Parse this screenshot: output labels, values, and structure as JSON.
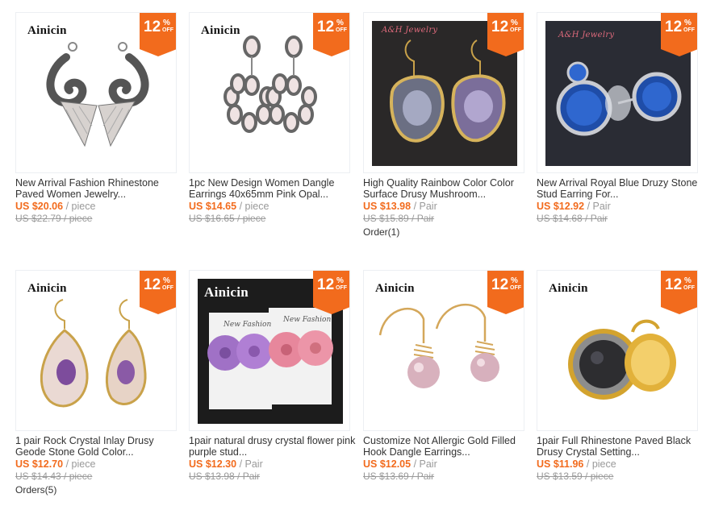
{
  "products": [
    {
      "brand": "Ainicin",
      "discount": "12",
      "pct": "%",
      "off": "OFF",
      "title": "New Arrival Fashion Rhinestone Paved Women Jewelry...",
      "price": "US $20.06",
      "unit": "/ piece",
      "orig": "US $22.79 / piece",
      "orders": ""
    },
    {
      "brand": "Ainicin",
      "discount": "12",
      "pct": "%",
      "off": "OFF",
      "title": "1pc New Design Women Dangle Earrings 40x65mm Pink Opal...",
      "price": "US $14.65",
      "unit": "/ piece",
      "orig": "US $16.65 / piece",
      "orders": ""
    },
    {
      "brand": "A&H Jewelry",
      "discount": "12",
      "pct": "%",
      "off": "OFF",
      "title": "High Quality Rainbow Color Color Surface Drusy Mushroom...",
      "price": "US $13.98",
      "unit": "/ Pair",
      "orig": "US $15.89 / Pair",
      "orders": "Order(1)"
    },
    {
      "brand": "A&H Jewelry",
      "discount": "12",
      "pct": "%",
      "off": "OFF",
      "title": "New Arrival Royal Blue Druzy Stone Stud Earring For...",
      "price": "US $12.92",
      "unit": "/ Pair",
      "orig": "US $14.68 / Pair",
      "orders": ""
    },
    {
      "brand": "Ainicin",
      "discount": "12",
      "pct": "%",
      "off": "OFF",
      "title": "1 pair Rock Crystal Inlay Drusy Geode Stone Gold Color...",
      "price": "US $12.70",
      "unit": "/ piece",
      "orig": "US $14.43 / piece",
      "orders": "Orders(5)"
    },
    {
      "brand": "Ainicin",
      "discount": "12",
      "pct": "%",
      "off": "OFF",
      "title": "1pair natural drusy crystal flower pink purple stud...",
      "price": "US $12.30",
      "unit": "/ Pair",
      "orig": "US $13.98 / Pair",
      "orders": "",
      "card_text": "New Fashion"
    },
    {
      "brand": "Ainicin",
      "discount": "12",
      "pct": "%",
      "off": "OFF",
      "title": "Customize Not Allergic Gold Filled Hook Dangle Earrings...",
      "price": "US $12.05",
      "unit": "/ Pair",
      "orig": "US $13.69 / Pair",
      "orders": ""
    },
    {
      "brand": "Ainicin",
      "discount": "12",
      "pct": "%",
      "off": "OFF",
      "title": "1pair Full Rhinestone Paved Black Drusy Crystal Setting...",
      "price": "US $11.96",
      "unit": "/ piece",
      "orig": "US $13.59 / piece",
      "orders": ""
    }
  ],
  "colors": {
    "accent": "#f26b1d",
    "text": "#333333",
    "muted": "#999999",
    "border": "#eceff3"
  },
  "icons": [
    "wing-earring-image",
    "flower-earring-image",
    "geode-earring-image",
    "blue-druzy-stud-image",
    "crystal-geode-earring-image",
    "flower-stud-image",
    "pearl-hook-earring-image",
    "black-druzy-earring-image"
  ]
}
